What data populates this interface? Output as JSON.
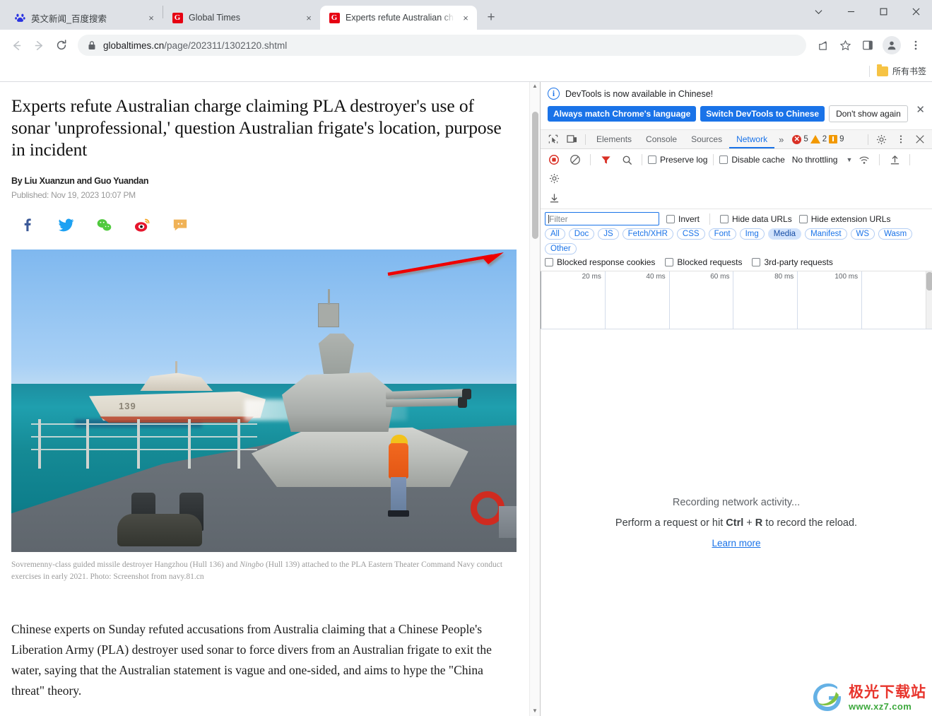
{
  "browser": {
    "tabs": [
      {
        "title": "英文新闻_百度搜索",
        "favicon": "baidu-icon",
        "active": false,
        "close_label": "×"
      },
      {
        "title": "Global Times",
        "favicon": "globaltimes-icon",
        "active": false,
        "close_label": "×"
      },
      {
        "title": "Experts refute Australian char",
        "favicon": "globaltimes-icon",
        "active": true,
        "close_label": "×"
      }
    ],
    "new_tab_label": "+",
    "window_controls": {
      "minimize": "minimize-icon",
      "maximize": "maximize-icon",
      "close": "close-icon",
      "more": "chevron-down-icon"
    },
    "nav": {
      "back": "back-arrow-icon",
      "forward": "forward-arrow-icon",
      "reload": "reload-icon"
    },
    "omnibox": {
      "lock": "lock-icon",
      "host": "globaltimes.cn",
      "path": "/page/202311/1302120.shtml",
      "full_url": "globaltimes.cn/page/202311/1302120.shtml"
    },
    "toolbar_icons": [
      "share-icon",
      "bookmark-star-icon",
      "side-panel-icon",
      "profile-avatar-icon",
      "kebab-menu-icon"
    ],
    "bookmarks": {
      "folder_icon": "folder-icon",
      "label": "所有书签"
    }
  },
  "article": {
    "headline": "Experts refute Australian charge claiming PLA destroyer's use of sonar 'unprofessional,' question Australian frigate's location, purpose in incident",
    "byline": "By Liu Xuanzun and Guo Yuandan",
    "published": "Published: Nov 19, 2023 10:07 PM",
    "social_icons": [
      "facebook-icon",
      "twitter-icon",
      "wechat-icon",
      "weibo-icon",
      "comment-icon"
    ],
    "photo": {
      "alt": "PLA Navy destroyers Hangzhou and Ningbo at sea",
      "far_ship_hull_number": "139"
    },
    "caption_part1": "Sovremenny-class guided missile destroyer Hangzhou (Hull 136) and ",
    "caption_italic": "Ningbo",
    "caption_part2": " (Hull 139) attached to the PLA Eastern Theater Command Navy conduct exercises in early 2021. Photo: Screenshot from navy.81.cn",
    "body": "Chinese experts on Sunday refuted accusations from Australia claiming that a Chinese People's Liberation Army (PLA) destroyer used sonar to force divers from an Australian frigate to exit the water, saying that the Australian statement is vague and one-sided, and aims to hype the \"China threat\" theory."
  },
  "devtools": {
    "notice": {
      "icon": "info-icon",
      "text": "DevTools is now available in Chinese!",
      "primary_button": "Always match Chrome's language",
      "secondary_button": "Switch DevTools to Chinese",
      "dismiss_button": "Don't show again",
      "close_label": "✕"
    },
    "tabs": [
      {
        "label": "Elements",
        "selected": false
      },
      {
        "label": "Console",
        "selected": false
      },
      {
        "label": "Sources",
        "selected": false
      },
      {
        "label": "Network",
        "selected": true
      }
    ],
    "more_tabs_label": "»",
    "left_icons": [
      "inspect-element-icon",
      "device-toolbar-icon"
    ],
    "badges": {
      "errors": "5",
      "warnings": "2",
      "issues": "9"
    },
    "right_icons": [
      "settings-gear-icon",
      "kebab-menu-icon",
      "close-devtools-icon"
    ],
    "network_toolbar": {
      "record_icon": "record-stop-icon",
      "clear_icon": "clear-icon",
      "filter_icon": "filter-funnel-icon",
      "search_icon": "search-icon",
      "preserve_log": "Preserve log",
      "disable_cache": "Disable cache",
      "throttling": "No throttling",
      "throttle_caret": "▼",
      "wifi_icon": "network-conditions-icon",
      "import_icon": "import-har-icon",
      "settings_icon": "settings-gear-icon",
      "export_icon": "export-har-icon"
    },
    "filter_row": {
      "placeholder": "Filter",
      "invert": "Invert",
      "hide_data_urls": "Hide data URLs",
      "hide_extension_urls": "Hide extension URLs"
    },
    "resource_types": [
      {
        "label": "All",
        "active": false
      },
      {
        "label": "Doc",
        "active": false
      },
      {
        "label": "JS",
        "active": false
      },
      {
        "label": "Fetch/XHR",
        "active": false
      },
      {
        "label": "CSS",
        "active": false
      },
      {
        "label": "Font",
        "active": false
      },
      {
        "label": "Img",
        "active": false
      },
      {
        "label": "Media",
        "active": true
      },
      {
        "label": "Manifest",
        "active": false
      },
      {
        "label": "WS",
        "active": false
      },
      {
        "label": "Wasm",
        "active": false
      },
      {
        "label": "Other",
        "active": false
      }
    ],
    "cookie_filters": [
      "Blocked response cookies",
      "Blocked requests",
      "3rd-party requests"
    ],
    "timeline_ticks": [
      "20 ms",
      "40 ms",
      "60 ms",
      "80 ms",
      "100 ms"
    ],
    "empty_state": {
      "line1": "Recording network activity...",
      "line2_pre": "Perform a request or hit ",
      "line2_key1": "Ctrl",
      "line2_plus": " + ",
      "line2_key2": "R",
      "line2_post": " to record the reload.",
      "link": "Learn more"
    }
  },
  "watermark": {
    "cn": "极光下载站",
    "url": "www.xz7.com",
    "logo": "aurora-logo-icon"
  },
  "colors": {
    "accent_blue": "#1a73e8",
    "tab_bar": "#dee1e6",
    "globaltimes_red": "#e60012",
    "annotation_red": "#ee0000",
    "media_chip_bg": "#d2e3fc"
  }
}
